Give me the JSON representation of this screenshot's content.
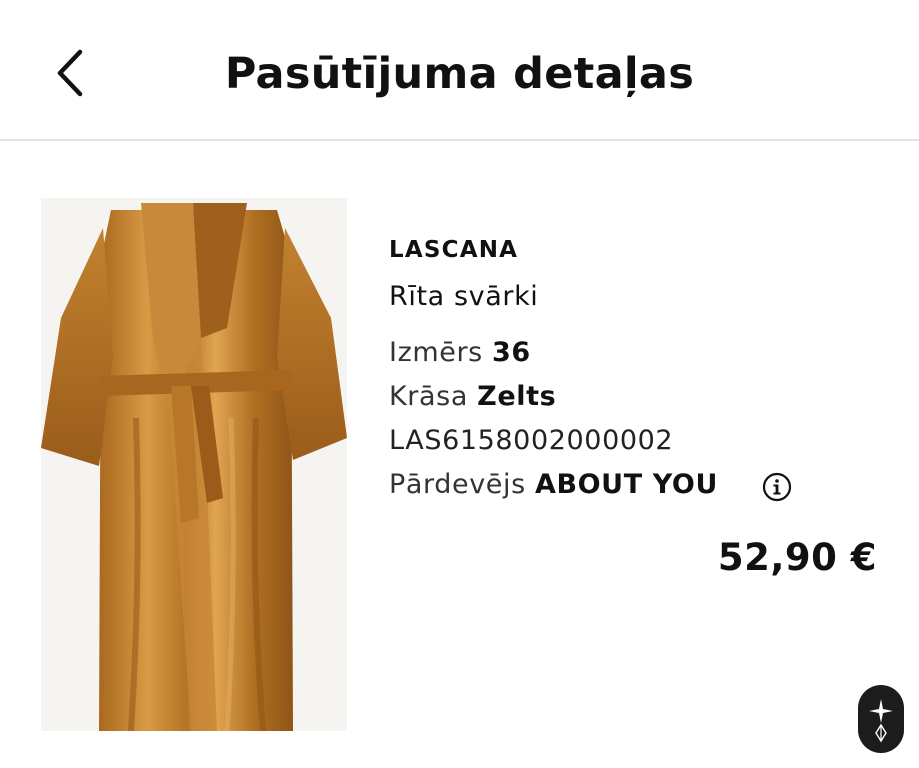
{
  "header": {
    "title": "Pasūtījuma detaļas",
    "back_icon": "chevron-left-icon"
  },
  "product": {
    "image_description_icon": "product-image",
    "brand": "LASCANA",
    "name": "Rīta svārki",
    "size_label": "Izmērs",
    "size_value": "36",
    "color_label": "Krāsa",
    "color_value": "Zelts",
    "sku": "LAS6158002000002",
    "seller_label": "Pārdevējs",
    "seller_value": "ABOUT YOU",
    "seller_info_icon": "info-icon",
    "price": "52,90 €"
  },
  "colors": {
    "text": "#111111",
    "divider": "#e3e3e3",
    "robe_gold": "#b8772a",
    "fab_bg": "#1c1c1c"
  },
  "floating_button": {
    "icon": "star-emblem-icon"
  }
}
